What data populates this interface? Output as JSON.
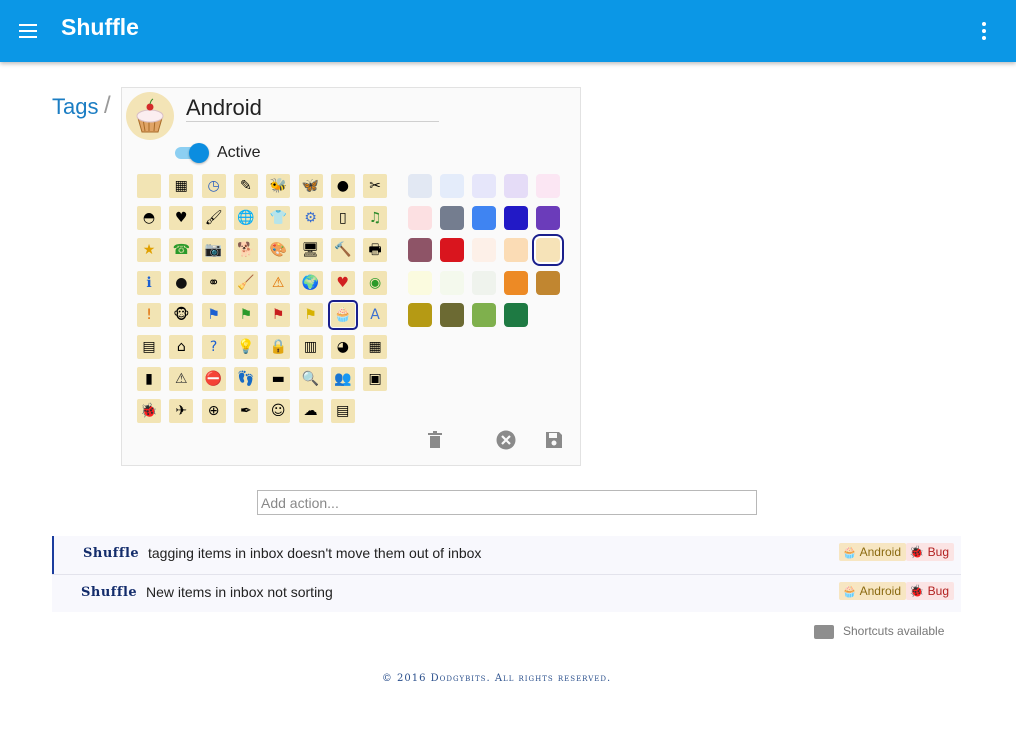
{
  "app": {
    "title": "Shuffle"
  },
  "breadcrumb": {
    "section": "Tags",
    "separator": "/"
  },
  "tag_editor": {
    "name": "Android",
    "active_label": "Active",
    "active": true,
    "selected_icon": "cupcake-icon",
    "selected_color": "#f6e3b8",
    "icons": [
      [
        "blank",
        "calculator",
        "clock",
        "notepad",
        "bee",
        "butterfly",
        "ball",
        "scissors"
      ],
      [
        "helmet",
        "cards",
        "brush",
        "globe",
        "shirt",
        "gear",
        "remote",
        "music"
      ],
      [
        "star",
        "phone",
        "camera",
        "dog",
        "palette",
        "computer",
        "hammer",
        "printer"
      ],
      [
        "info",
        "eightball",
        "binoculars",
        "broom",
        "warning-triangle",
        "earth",
        "heart",
        "lifebuoy"
      ],
      [
        "alert",
        "monkey",
        "flag-blue",
        "flag-green",
        "flag-red",
        "flag-yellow",
        "cupcake",
        "letter-a"
      ],
      [
        "document",
        "house",
        "help",
        "lightbulb",
        "lock",
        "calendar-note",
        "pie-chart",
        "calendar"
      ],
      [
        "phone-handset",
        "caution",
        "stop",
        "footprints",
        "book",
        "magnifier",
        "people",
        "picture"
      ],
      [
        "ladybug",
        "airplane",
        "zoom",
        "pen",
        "smiley",
        "cloud",
        "contacts"
      ]
    ],
    "colors": [
      [
        "#e2e8f3",
        "#e4ecfa",
        "#e6e6fa",
        "#e5dcf7",
        "#fbe6f3"
      ],
      [
        "#fce0e2",
        "#747d8f",
        "#3f84f2",
        "#2219c6",
        "#6b3cba"
      ],
      [
        "#8e5467",
        "#d9151e",
        "#fdf0e8",
        "#fbdcb5",
        "#f6e3b8"
      ],
      [
        "#fbfbdf",
        "#f4f9ed",
        "#eff3ed",
        "#ed8a25",
        "#c18630"
      ],
      [
        "#b59a14",
        "#6c6a33",
        "#7fb04d",
        "#1e7a43"
      ]
    ]
  },
  "toolbar": {
    "delete": "trash-icon",
    "cancel": "close-circle-icon",
    "save": "save-icon"
  },
  "add_action": {
    "placeholder": "Add action...",
    "value": ""
  },
  "tasks": [
    {
      "project": "Shuffle",
      "text": "tagging items in inbox doesn't move them out of inbox",
      "tags": [
        "Android",
        "Bug"
      ]
    },
    {
      "project": "Shuffle",
      "text": "New items in inbox not sorting",
      "tags": [
        "Android",
        "Bug"
      ]
    }
  ],
  "shortcuts": {
    "label": "Shortcuts available"
  },
  "footer": {
    "text": "© 2016 Dodgybits. All rights reserved."
  }
}
